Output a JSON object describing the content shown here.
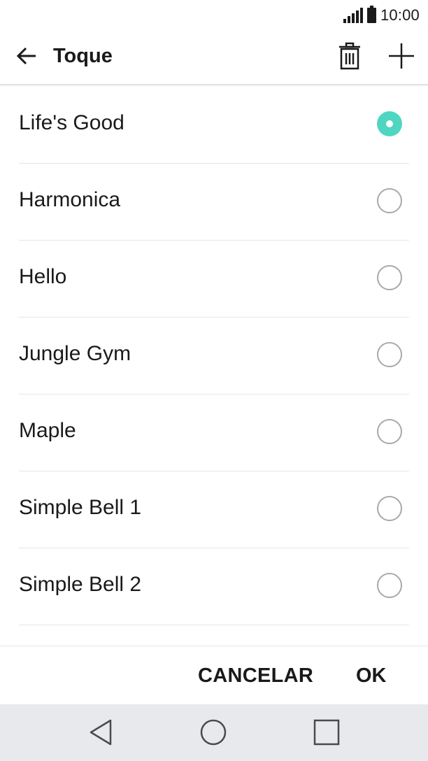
{
  "status_bar": {
    "time": "10:00",
    "signal_icon": "signal-bars-icon",
    "battery_icon": "battery-icon"
  },
  "app_bar": {
    "title": "Toque",
    "back_icon": "arrow-left-icon",
    "delete_icon": "trash-icon",
    "add_icon": "plus-icon"
  },
  "ringtones": [
    {
      "label": "Life's Good",
      "selected": true
    },
    {
      "label": "Harmonica",
      "selected": false
    },
    {
      "label": "Hello",
      "selected": false
    },
    {
      "label": "Jungle Gym",
      "selected": false
    },
    {
      "label": "Maple",
      "selected": false
    },
    {
      "label": "Simple Bell 1",
      "selected": false
    },
    {
      "label": "Simple Bell 2",
      "selected": false
    }
  ],
  "actions": {
    "cancel_label": "CANCELAR",
    "ok_label": "OK"
  },
  "nav_bar": {
    "back_icon": "nav-back-triangle-icon",
    "home_icon": "nav-home-circle-icon",
    "recents_icon": "nav-recents-square-icon"
  },
  "colors": {
    "accent": "#4fd6c0",
    "nav_background": "#e8e9ec",
    "divider": "#e6e6e6",
    "radio_border": "#a9a9a9"
  }
}
